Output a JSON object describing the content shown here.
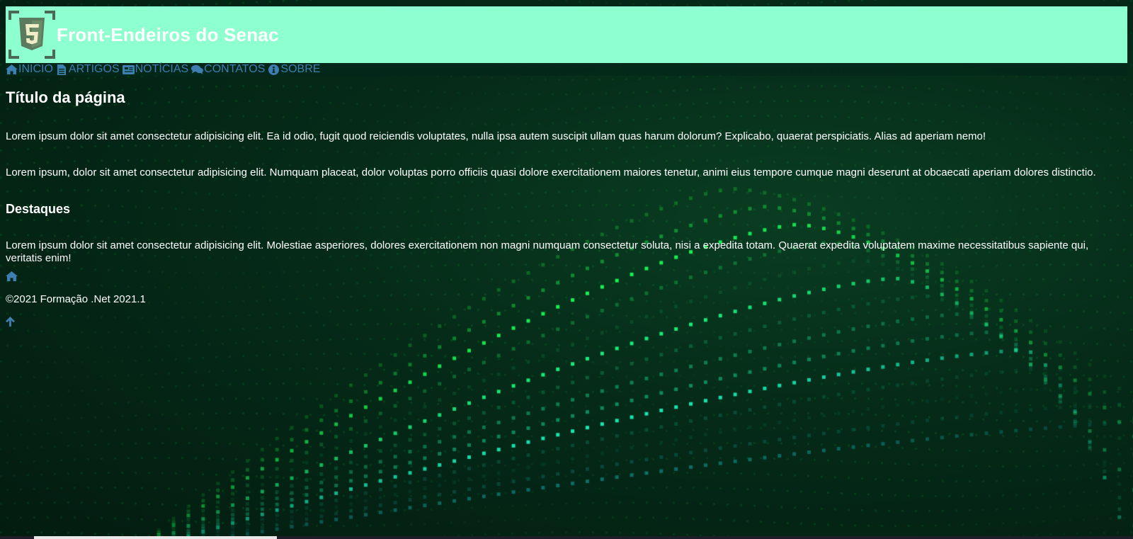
{
  "header": {
    "logo_icon": "html5-badge-icon",
    "title": "Front-Endeiros do Senac",
    "background": "#8effce"
  },
  "nav": {
    "link_color": "#3c7fb0",
    "items": [
      {
        "label": "INICIO",
        "icon": "home-icon"
      },
      {
        "label": "ARTIGOS",
        "icon": "file-icon"
      },
      {
        "label": "NOTÍCIAS",
        "icon": "newspaper-icon"
      },
      {
        "label": "CONTATOS",
        "icon": "comments-icon"
      },
      {
        "label": "SOBRE",
        "icon": "info-circle-icon"
      }
    ]
  },
  "main": {
    "page_title": "Título da página",
    "paragraph_1": "Lorem ipsum dolor sit amet consectetur adipisicing elit. Ea id odio, fugit quod reiciendis voluptates, nulla ipsa autem suscipit ullam quas harum dolorum? Explicabo, quaerat perspiciatis. Alias ad aperiam nemo!",
    "paragraph_2": "Lorem ipsum, dolor sit amet consectetur adipisicing elit. Numquam placeat, dolor voluptas porro officiis quasi dolore exercitationem maiores tenetur, animi eius tempore cumque magni deserunt at obcaecati aperiam dolores distinctio.",
    "section_title": "Destaques",
    "paragraph_3": "Lorem ipsum dolor sit amet consectetur adipisicing elit. Molestiae asperiores, dolores exercitationem non magni numquam consectetur soluta, nisi a expedita totam. Quaerat expedita voluptatem maxime necessitatibus sapiente qui, veritatis enim!"
  },
  "footer": {
    "home_icon": "home-icon",
    "copyright": "©2021 Formação .Net 2021.1",
    "back_to_top_icon": "arrow-up-icon"
  },
  "colors": {
    "background": "#052a18",
    "text": "#ffffff",
    "dots_green": "#19ff3a",
    "dots_cyan": "#18e8f0"
  }
}
